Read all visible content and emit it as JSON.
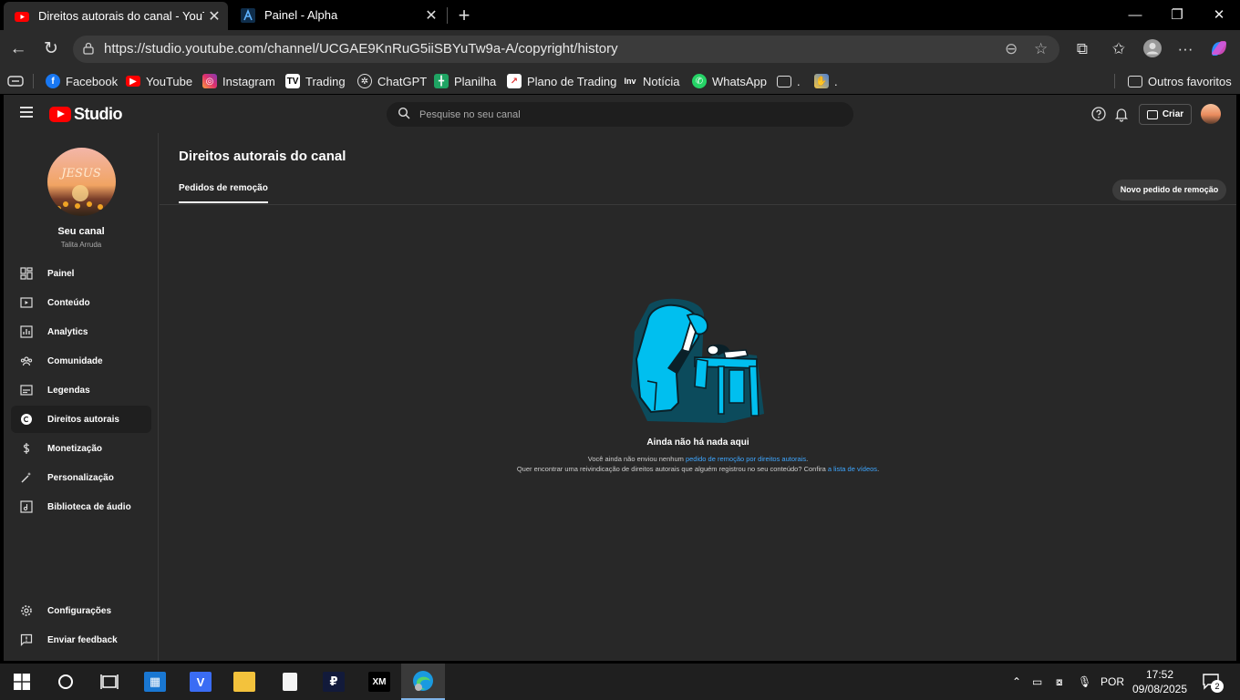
{
  "browser": {
    "tabs": [
      {
        "title": "Direitos autorais do canal - YouTu"
      },
      {
        "title": "Painel - Alpha"
      }
    ],
    "url": "https://studio.youtube.com/channel/UCGAE9KnRuG5iiSBYuTw9a-A/copyright/history",
    "bookmarks": [
      {
        "label": "Facebook",
        "icon": "facebook-icon",
        "color": "#1877f2"
      },
      {
        "label": "YouTube",
        "icon": "youtube-icon",
        "color": "#ff0000"
      },
      {
        "label": "Instagram",
        "icon": "instagram-icon",
        "color": "#e1306c"
      },
      {
        "label": "Trading",
        "icon": "tradingview-icon",
        "color": "#000000"
      },
      {
        "label": "ChatGPT",
        "icon": "chatgpt-icon",
        "color": "#2b2b2b"
      },
      {
        "label": "Planilha",
        "icon": "sheets-icon",
        "color": "#1fa463"
      },
      {
        "label": "Plano de Trading",
        "icon": "chart-icon",
        "color": "#ffffff"
      },
      {
        "label": "Notícia",
        "icon": "investing-icon",
        "color": "#2b2b2b"
      },
      {
        "label": "WhatsApp",
        "icon": "whatsapp-icon",
        "color": "#25d366"
      },
      {
        "label": ".",
        "icon": "folder-icon",
        "color": "#2b2b2b"
      },
      {
        "label": ".",
        "icon": "hands-icon",
        "color": "#2b2b2b"
      }
    ],
    "other_favorites": "Outros favoritos"
  },
  "studio": {
    "logo_text": "Studio",
    "search_placeholder": "Pesquise no seu canal",
    "create_label": "Criar",
    "channel": {
      "name": "Seu canal",
      "handle": "Talita Arruda",
      "avatar_text": "JESUS"
    },
    "nav": [
      {
        "label": "Painel",
        "icon": "dashboard-icon"
      },
      {
        "label": "Conteúdo",
        "icon": "content-icon"
      },
      {
        "label": "Analytics",
        "icon": "analytics-icon"
      },
      {
        "label": "Comunidade",
        "icon": "community-icon"
      },
      {
        "label": "Legendas",
        "icon": "subtitles-icon"
      },
      {
        "label": "Direitos autorais",
        "icon": "copyright-icon",
        "active": true
      },
      {
        "label": "Monetização",
        "icon": "monetization-icon"
      },
      {
        "label": "Personalização",
        "icon": "customization-icon"
      },
      {
        "label": "Biblioteca de áudio",
        "icon": "audio-library-icon"
      }
    ],
    "bottom_nav": [
      {
        "label": "Configurações",
        "icon": "settings-icon"
      },
      {
        "label": "Enviar feedback",
        "icon": "feedback-icon"
      }
    ],
    "page_title": "Direitos autorais do canal",
    "tab": "Pedidos de remoção",
    "new_request_button": "Novo pedido de remoção",
    "empty": {
      "title": "Ainda não há nada aqui",
      "line1_prefix": "Você ainda não enviou nenhum ",
      "line1_link": "pedido de remoção por direitos autorais",
      "line1_suffix": ".",
      "line2_prefix": "Quer encontrar uma reivindicação de direitos autorais que alguém registrou no seu conteúdo? Confira ",
      "line2_link": "a lista de vídeos",
      "line2_suffix": "."
    }
  },
  "taskbar": {
    "language": "POR",
    "time": "17:52",
    "date": "09/08/2025",
    "notifications": "2"
  }
}
